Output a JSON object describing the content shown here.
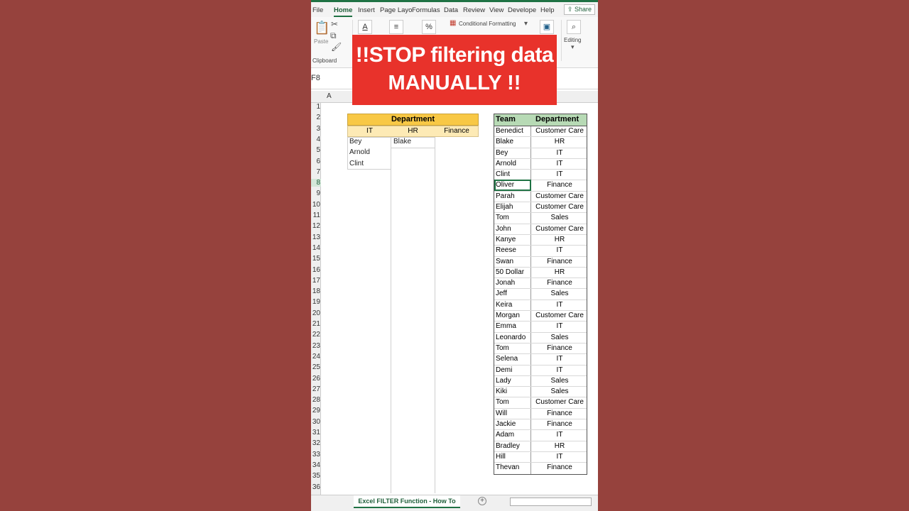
{
  "colors": {
    "background": "#96423d",
    "banner": "#e8322b",
    "excel_green": "#1f7244",
    "dept_header": "#f8c845",
    "team_header": "#b7dab5"
  },
  "banner": {
    "line1": "!!STOP filtering data",
    "line2": "MANUALLY !!"
  },
  "ribbon": {
    "tabs": [
      "File",
      "Home",
      "Insert",
      "Page Layo",
      "Formulas",
      "Data",
      "Review",
      "View",
      "Develope",
      "Help"
    ],
    "share_label": "Share",
    "paste_label": "Paste",
    "clipboard_label": "Clipboard",
    "conditional_formatting": "Conditional Formatting",
    "editing_label": "Editing",
    "percent": "%"
  },
  "formula_bar": {
    "name_box": "F8"
  },
  "col_header": {
    "a": "A"
  },
  "rows": [
    "1",
    "2",
    "3",
    "4",
    "5",
    "6",
    "7",
    "8",
    "9",
    "10",
    "11",
    "12",
    "13",
    "14",
    "15",
    "16",
    "17",
    "18",
    "19",
    "20",
    "21",
    "22",
    "23",
    "24",
    "25",
    "26",
    "27",
    "28",
    "29",
    "30",
    "31",
    "32",
    "33",
    "34",
    "35",
    "36"
  ],
  "filter_table": {
    "header": "Department",
    "columns": [
      "IT",
      "HR",
      "Finance"
    ],
    "it": [
      "Bey",
      "Arnold",
      "Clint"
    ],
    "hr": [
      "Blake"
    ]
  },
  "team_table": {
    "headers": [
      "Team",
      "Department"
    ],
    "rows": [
      [
        "Benedict",
        "Customer Care"
      ],
      [
        "Blake",
        "HR"
      ],
      [
        "Bey",
        "IT"
      ],
      [
        "Arnold",
        "IT"
      ],
      [
        "Clint",
        "IT"
      ],
      [
        "Oliver",
        "Finance"
      ],
      [
        "Parah",
        "Customer Care"
      ],
      [
        "Elijah",
        "Customer Care"
      ],
      [
        "Tom",
        "Sales"
      ],
      [
        "John",
        "Customer Care"
      ],
      [
        "Kanye",
        "HR"
      ],
      [
        "Reese",
        "IT"
      ],
      [
        "Swan",
        "Finance"
      ],
      [
        "50 Dollar",
        "HR"
      ],
      [
        "Jonah",
        "Finance"
      ],
      [
        "Jeff",
        "Sales"
      ],
      [
        "Keira",
        "IT"
      ],
      [
        "Morgan",
        "Customer Care"
      ],
      [
        "Emma",
        "IT"
      ],
      [
        "Leonardo",
        "Sales"
      ],
      [
        "Tom",
        "Finance"
      ],
      [
        "Selena",
        "IT"
      ],
      [
        "Demi",
        "IT"
      ],
      [
        "Lady",
        "Sales"
      ],
      [
        "Kiki",
        "Sales"
      ],
      [
        "Tom",
        "Customer Care"
      ],
      [
        "Will",
        "Finance"
      ],
      [
        "Jackie",
        "Finance"
      ],
      [
        "Adam",
        "IT"
      ],
      [
        "Bradley",
        "HR"
      ],
      [
        "Hill",
        "IT"
      ],
      [
        "Thevan",
        "Finance"
      ]
    ]
  },
  "sheet": {
    "tab_label": "Excel FILTER Function - How To",
    "add_icon": "+"
  }
}
